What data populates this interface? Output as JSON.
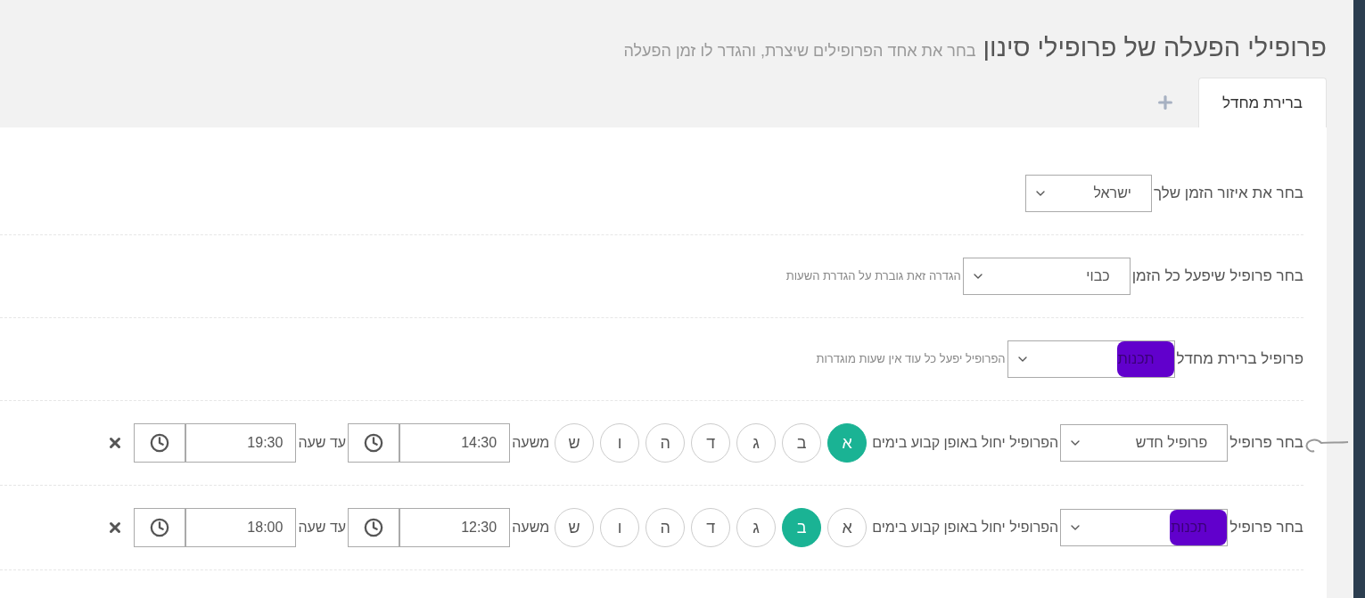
{
  "header": {
    "title": "פרופילי הפעלה של פרופילי סינון",
    "subtitle": "בחר את אחד הפרופילים שיצרת, והגדר לו זמן הפעלה"
  },
  "tabs": [
    {
      "label": "ברירת מחדל",
      "selected": true
    }
  ],
  "settings": [
    {
      "label": "בחר את איזור הזמן שלך",
      "value": "ישראל",
      "redacted": false
    },
    {
      "label": "בחר פרופיל שיפעל כל הזמן",
      "value": "כבוי",
      "hint": "הגדרה זאת גוברת על הגדרת השעות",
      "redacted": false
    },
    {
      "label": "פרופיל ברירת מחדל",
      "value": "תכנות",
      "hint": "הפרופיל יפעל כל עוד אין שעות מוגדרות",
      "redacted": true
    }
  ],
  "schedules": [
    {
      "label": "בחר פרופיל",
      "profile": "פרופיל חדש",
      "redacted": false,
      "marked": true,
      "days_label": "הפרופיל יחול באופן קבוע בימים",
      "days": [
        {
          "label": "א",
          "selected": true
        },
        {
          "label": "ב",
          "selected": false
        },
        {
          "label": "ג",
          "selected": false
        },
        {
          "label": "ד",
          "selected": false
        },
        {
          "label": "ה",
          "selected": false
        },
        {
          "label": "ו",
          "selected": false
        },
        {
          "label": "ש",
          "selected": false
        }
      ],
      "from_label": "משעה",
      "from": "14:30",
      "to_label": "עד שעה",
      "to": "19:30"
    },
    {
      "label": "בחר פרופיל",
      "profile": "תכנות",
      "redacted": true,
      "marked": false,
      "days_label": "הפרופיל יחול באופן קבוע בימים",
      "days": [
        {
          "label": "א",
          "selected": false
        },
        {
          "label": "ב",
          "selected": true
        },
        {
          "label": "ג",
          "selected": false
        },
        {
          "label": "ד",
          "selected": false
        },
        {
          "label": "ה",
          "selected": false
        },
        {
          "label": "ו",
          "selected": false
        },
        {
          "label": "ש",
          "selected": false
        }
      ],
      "from_label": "משעה",
      "from": "12:30",
      "to_label": "עד שעה",
      "to": "18:00"
    }
  ]
}
